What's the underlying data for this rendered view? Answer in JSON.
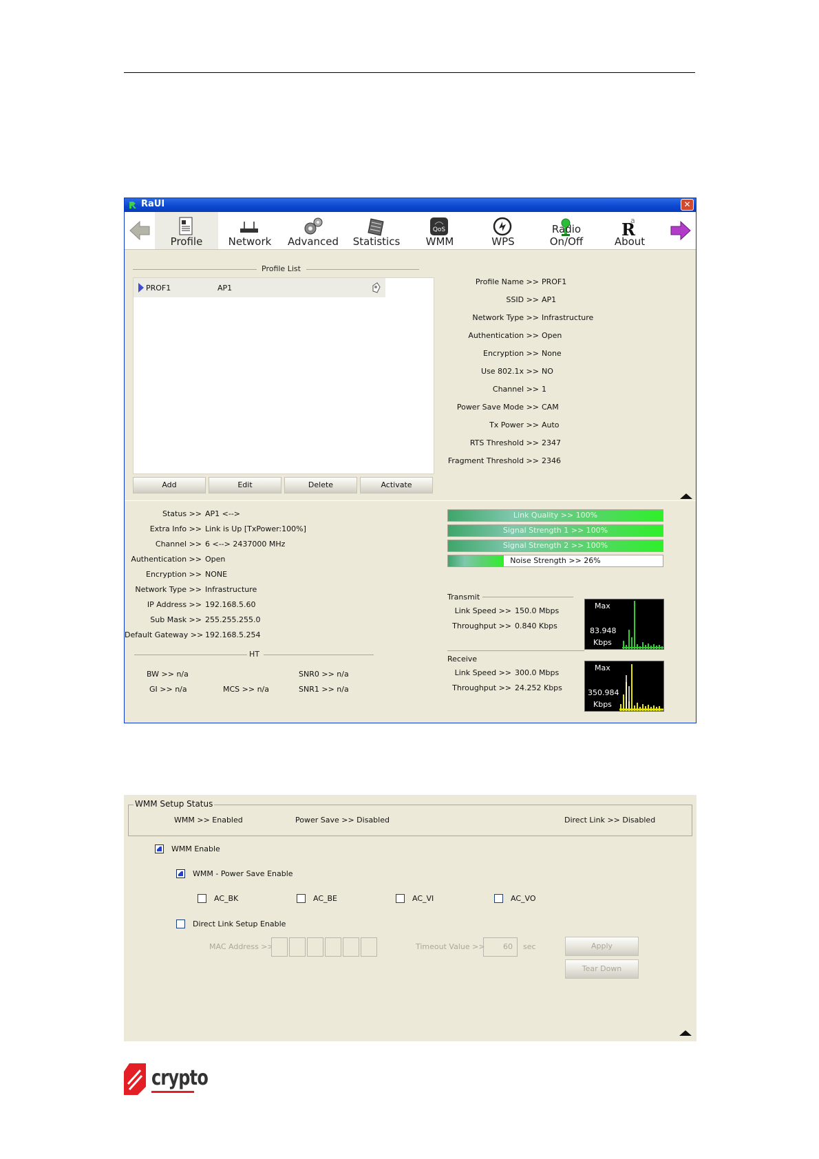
{
  "app": {
    "title": "RaUI",
    "close": "✕"
  },
  "toolbar": {
    "items": [
      {
        "label": "Profile",
        "icon": "profile-icon"
      },
      {
        "label": "Network",
        "icon": "network-icon"
      },
      {
        "label": "Advanced",
        "icon": "gears-icon"
      },
      {
        "label": "Statistics",
        "icon": "statistics-icon"
      },
      {
        "label": "WMM",
        "icon": "qos-icon"
      },
      {
        "label": "WPS",
        "icon": "wps-icon"
      },
      {
        "label": "Radio On/Off",
        "icon": "radio-icon"
      },
      {
        "label": "About",
        "icon": "about-icon"
      }
    ]
  },
  "profile_list": {
    "title": "Profile List",
    "rows": [
      {
        "name": "PROF1",
        "ssid": "AP1"
      }
    ],
    "buttons": {
      "add": "Add",
      "edit": "Edit",
      "delete": "Delete",
      "activate": "Activate"
    }
  },
  "profile_details": [
    {
      "label": "Profile Name >>",
      "value": "PROF1"
    },
    {
      "label": "SSID >>",
      "value": "AP1"
    },
    {
      "label": "Network Type >>",
      "value": "Infrastructure"
    },
    {
      "label": "Authentication >>",
      "value": "Open"
    },
    {
      "label": "Encryption >>",
      "value": "None"
    },
    {
      "label": "Use 802.1x >>",
      "value": "NO"
    },
    {
      "label": "Channel >>",
      "value": "1"
    },
    {
      "label": "Power Save Mode >>",
      "value": "CAM"
    },
    {
      "label": "Tx Power >>",
      "value": "Auto"
    },
    {
      "label": "RTS Threshold >>",
      "value": "2347"
    },
    {
      "label": "Fragment Threshold >>",
      "value": "2346"
    }
  ],
  "status": [
    {
      "label": "Status >>",
      "value": "AP1 <-->"
    },
    {
      "label": "Extra Info >>",
      "value": "Link is Up [TxPower:100%]"
    },
    {
      "label": "Channel >>",
      "value": "6 <--> 2437000 MHz"
    },
    {
      "label": "Authentication >>",
      "value": "Open"
    },
    {
      "label": "Encryption >>",
      "value": "NONE"
    },
    {
      "label": "Network Type >>",
      "value": "Infrastructure"
    },
    {
      "label": "IP Address >>",
      "value": "192.168.5.60"
    },
    {
      "label": "Sub Mask >>",
      "value": "255.255.255.0"
    },
    {
      "label": "Default Gateway >>",
      "value": "192.168.5.254"
    }
  ],
  "ht": {
    "title": "HT",
    "bw": "BW >> n/a",
    "gi": "GI >> n/a",
    "mcs": "MCS >> n/a",
    "snr0": "SNR0 >> n/a",
    "snr1": "SNR1 >> n/a"
  },
  "signal": [
    {
      "label": "Link Quality >> 100%",
      "percent": 100
    },
    {
      "label": "Signal Strength 1 >> 100%",
      "percent": 100
    },
    {
      "label": "Signal Strength 2 >> 100%",
      "percent": 100
    },
    {
      "label": "Noise Strength >> 26%",
      "percent": 26
    }
  ],
  "transmit": {
    "title": "Transmit",
    "link_speed_label": "Link Speed >>",
    "link_speed": "150.0 Mbps",
    "throughput_label": "Throughput >>",
    "throughput": "0.840 Kbps",
    "graph_max": "Max",
    "graph_value": "83.948",
    "graph_unit": "Kbps",
    "graph_color": "#33cc33"
  },
  "receive": {
    "title": "Receive",
    "link_speed_label": "Link Speed >>",
    "link_speed": "300.0 Mbps",
    "throughput_label": "Throughput >>",
    "throughput": "24.252 Kbps",
    "graph_max": "Max",
    "graph_value": "350.984",
    "graph_unit": "Kbps",
    "graph_color": "#e6e600"
  },
  "wmm": {
    "group_title": "WMM Setup Status",
    "wmm_status": "WMM >> Enabled",
    "power_save_status": "Power Save >> Disabled",
    "direct_link_status": "Direct Link >> Disabled",
    "wmm_enable": {
      "label": "WMM Enable",
      "checked": true
    },
    "power_save_enable": {
      "label": "WMM - Power Save Enable",
      "checked": true
    },
    "ac": [
      {
        "label": "AC_BK",
        "checked": false
      },
      {
        "label": "AC_BE",
        "checked": false
      },
      {
        "label": "AC_VI",
        "checked": false
      },
      {
        "label": "AC_VO",
        "checked": false
      }
    ],
    "direct_link_enable": {
      "label": "Direct Link Setup Enable",
      "checked": false
    },
    "mac_label": "MAC Address >>",
    "timeout_label": "Timeout Value >>",
    "timeout_value": "60",
    "timeout_unit": "sec",
    "apply": "Apply",
    "teardown": "Tear Down"
  },
  "logo": {
    "text": "crypto",
    "color": "#e31e24"
  }
}
